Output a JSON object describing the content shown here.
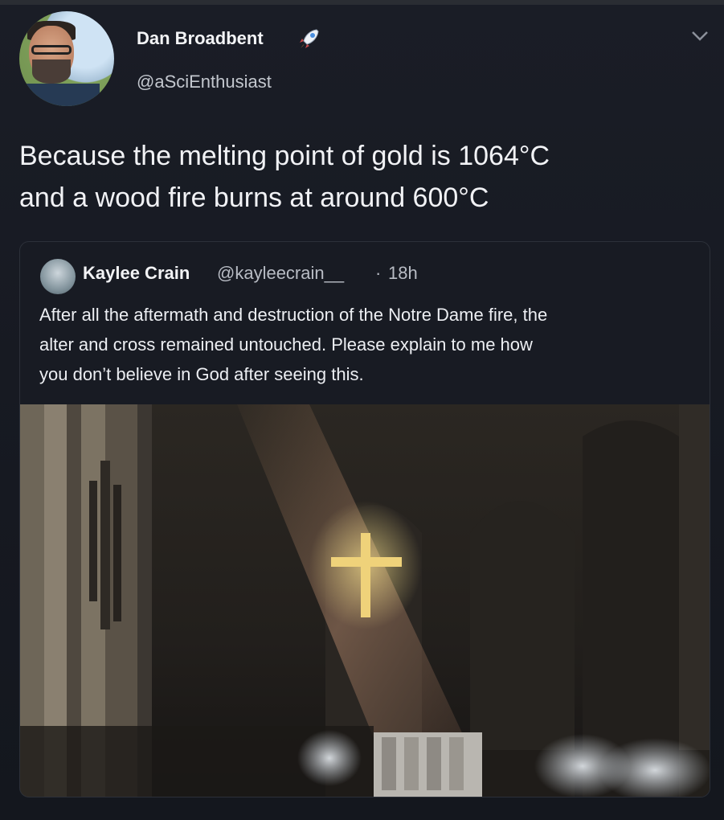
{
  "author": {
    "display_name": "Dan Broadbent",
    "handle": "@aSciEnthusiast"
  },
  "tweet": {
    "text_line1": "Because the melting point of gold is 1064°C",
    "text_line2": "and a wood fire burns at around 600°C"
  },
  "quoted_tweet": {
    "display_name": "Kaylee Crain",
    "handle": "@kayleecrain__",
    "separator": "·",
    "time": "18h",
    "text_line1": "After all the aftermath and destruction of the Notre Dame fire, the",
    "text_line2": "alter and cross remained untouched. Please explain to me how",
    "text_line3": "you don’t believe in God after seeing this."
  },
  "icons": {
    "badge": "rocket-icon",
    "menu": "chevron-down-icon"
  },
  "colors": {
    "background": "#1a1d26",
    "text": "#f1f2f5",
    "secondary_text": "#b8bcc4",
    "quote_border": "#2c3039"
  }
}
